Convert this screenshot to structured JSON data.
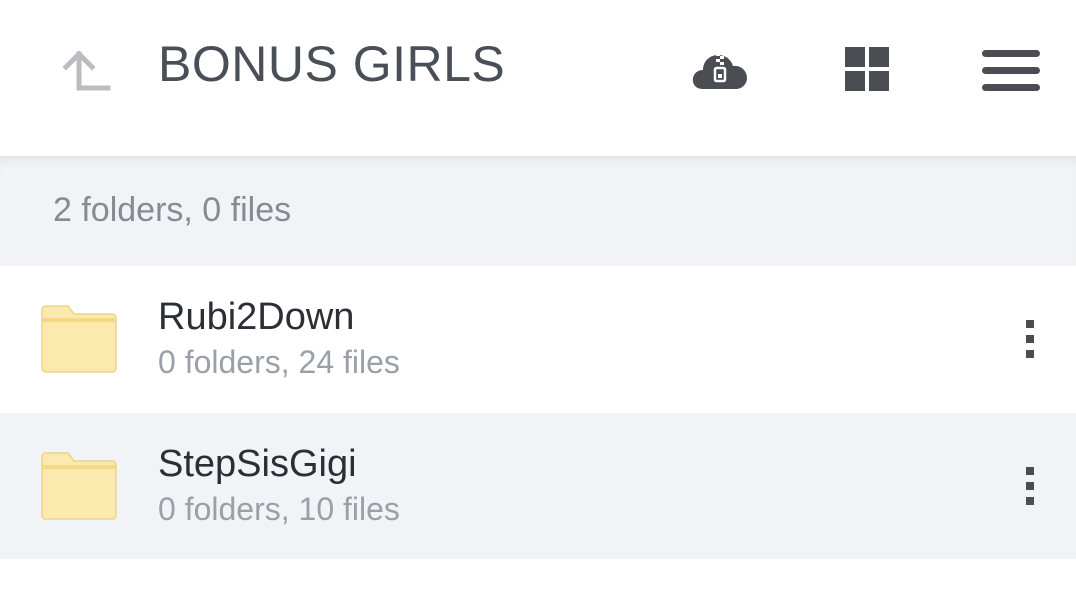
{
  "header": {
    "title": "BONUS GIRLS",
    "icons": {
      "up": "up-arrow-icon",
      "cloud": "cloud-zip-icon",
      "grid": "grid-view-icon",
      "menu": "hamburger-menu-icon"
    }
  },
  "summary": {
    "text": "2 folders, 0 files"
  },
  "items": [
    {
      "name": "Rubi2Down",
      "meta": "0 folders, 24 files",
      "icon": "folder-icon"
    },
    {
      "name": "StepSisGigi",
      "meta": "0 folders, 10 files",
      "icon": "folder-icon"
    }
  ],
  "colors": {
    "title": "#4a4f57",
    "icon_dark": "#4a4d52",
    "icon_light": "#b9bcc1",
    "summary_bg": "#f1f3f6",
    "folder_fill": "#fbe9ad",
    "folder_stroke": "#eed486"
  }
}
